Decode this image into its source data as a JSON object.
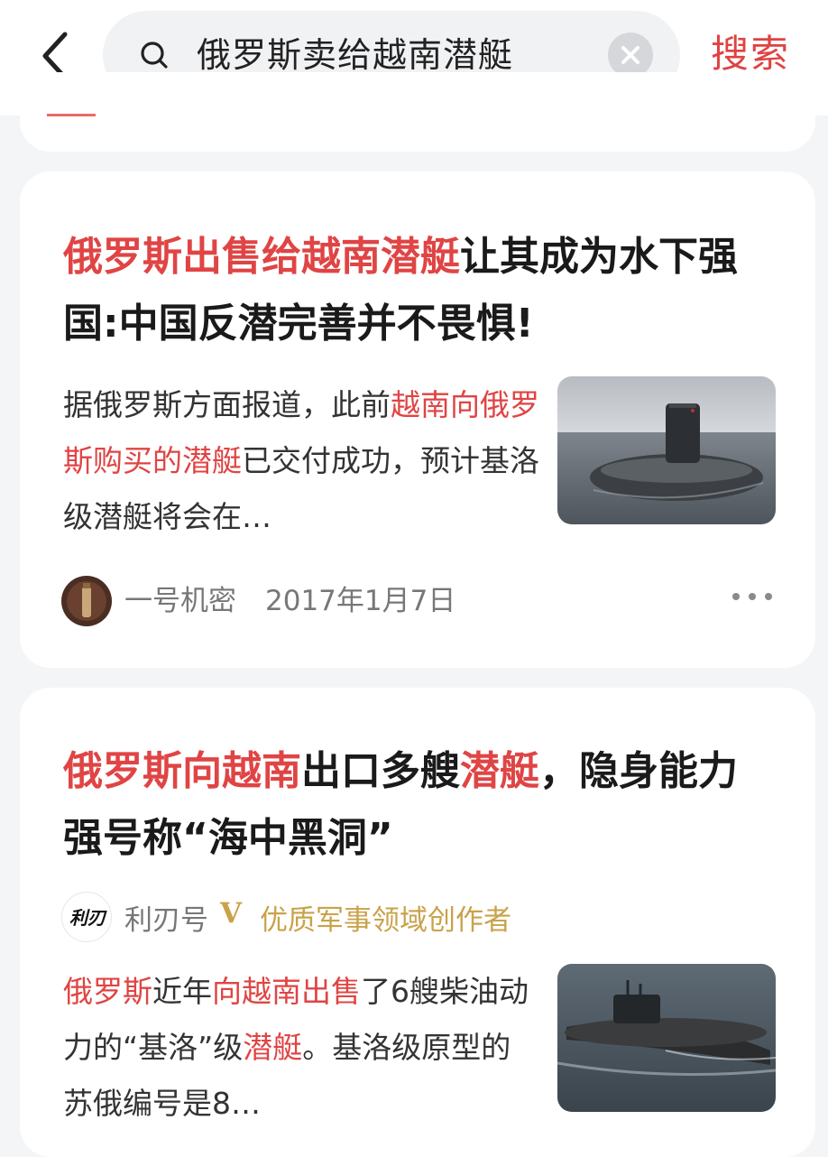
{
  "search": {
    "query": "俄罗斯卖给越南潜艇",
    "action_label": "搜索"
  },
  "results": [
    {
      "title_highlight": "俄罗斯出售给越南潜艇",
      "title_rest": "让其成为水下强国:中国反潜完善并不畏惧!",
      "snippet": {
        "part1": "据俄罗斯方面报道，此前",
        "highlight": "越南向俄罗斯购买的潜艇",
        "part2": "已交付成功，预计基洛级潜艇将会在…"
      },
      "author": "一号机密",
      "date": "2017年1月7日",
      "thumbnail": "submarine-photo"
    },
    {
      "title_h1": "俄罗斯向越南",
      "title_p1": "出口多艘",
      "title_h2": "潜艇",
      "title_p2": "，隐身能力强号称“海中黑洞”",
      "author": "利刃号",
      "avatar_text": "利刃",
      "verified_mark": "V",
      "author_badge": "优质军事领域创作者",
      "snippet": {
        "h1": "俄罗斯",
        "p1": "近年",
        "h2": "向越南出售",
        "p2": "了6艘柴油动力的“基洛”级",
        "h3": "潜艇",
        "p3": "。基洛级原型的苏俄编号是8…"
      },
      "thumbnail": "submarine-photo"
    }
  ],
  "colors": {
    "highlight": "#e04444",
    "badge_gold": "#c9a24a",
    "meta_gray": "#777777"
  }
}
